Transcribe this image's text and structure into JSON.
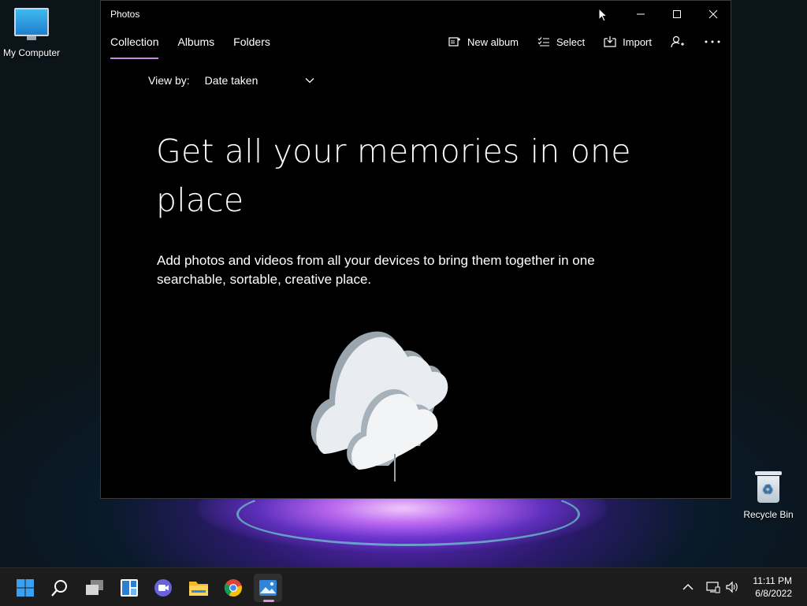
{
  "desktop": {
    "icons": [
      {
        "label": "My Computer",
        "icon": "computer-icon"
      },
      {
        "label": "Recycle Bin",
        "icon": "recycle-bin-icon"
      }
    ]
  },
  "window": {
    "title": "Photos",
    "controls": {
      "minimize": "minimize-icon",
      "maximize": "maximize-icon",
      "close": "close-icon"
    },
    "tabs": [
      {
        "label": "Collection",
        "active": true
      },
      {
        "label": "Albums",
        "active": false
      },
      {
        "label": "Folders",
        "active": false
      }
    ],
    "toolbar": {
      "new_album": "New album",
      "select": "Select",
      "import": "Import",
      "account_icon": "person-add-icon",
      "more_icon": "more-icon"
    },
    "view_by": {
      "label": "View by:",
      "selected": "Date taken"
    },
    "empty_state": {
      "headline_line1": "Get all your memories in one",
      "headline_line2": "place",
      "description_line1": "Add photos and videos from all your devices to bring them together in one",
      "description_line2": "searchable, sortable, creative place."
    }
  },
  "taskbar": {
    "apps": [
      "start-icon",
      "search-icon",
      "task-view-icon",
      "widgets-icon",
      "chat-icon",
      "file-explorer-icon",
      "chrome-icon",
      "photos-icon"
    ],
    "active_app": "photos-icon",
    "tray": {
      "time": "11:11 PM",
      "date": "6/8/2022"
    }
  },
  "colors": {
    "accent": "#c48ae6",
    "window_bg": "#000000",
    "taskbar_bg": "#1c1c1c"
  }
}
